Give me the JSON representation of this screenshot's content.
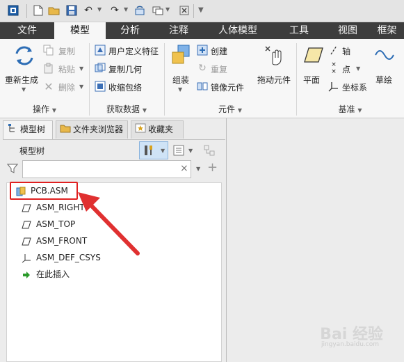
{
  "tabs": [
    {
      "label": "文件",
      "active": false
    },
    {
      "label": "模型",
      "active": true
    },
    {
      "label": "分析",
      "active": false
    },
    {
      "label": "注释",
      "active": false
    },
    {
      "label": "人体模型",
      "active": false
    },
    {
      "label": "工具",
      "active": false
    },
    {
      "label": "视图",
      "active": false
    },
    {
      "label": "框架",
      "active": false
    }
  ],
  "ribbon": {
    "operations": {
      "regenerate": "重新生成",
      "copy": "复制",
      "paste": "粘贴",
      "delete": "删除",
      "group": "操作"
    },
    "get_data": {
      "udf": "用户定义特征",
      "copy_geometry": "复制几何",
      "shrinkwrap": "收缩包络",
      "group": "获取数据"
    },
    "component": {
      "assemble": "组装",
      "create": "创建",
      "repeat": "重复",
      "mirror": "镜像元件",
      "drag": "拖动元件",
      "group": "元件"
    },
    "datum": {
      "plane": "平面",
      "axis": "轴",
      "point": "点",
      "csys": "坐标系",
      "sketch": "草绘",
      "group": "基准"
    }
  },
  "panel": {
    "tabs": [
      "模型树",
      "文件夹浏览器",
      "收藏夹"
    ],
    "tree_title": "模型树",
    "filter_value": "",
    "items": [
      {
        "label": "PCB.ASM",
        "icon": "assembly-icon"
      },
      {
        "label": "ASM_RIGHT",
        "icon": "datum-plane-icon"
      },
      {
        "label": "ASM_TOP",
        "icon": "datum-plane-icon"
      },
      {
        "label": "ASM_FRONT",
        "icon": "datum-plane-icon"
      },
      {
        "label": "ASM_DEF_CSYS",
        "icon": "csys-icon"
      },
      {
        "label": "在此插入",
        "icon": "insert-arrow-icon"
      }
    ]
  },
  "watermark": {
    "text": "Bai 经验",
    "sub": "jingyan.baidu.com"
  },
  "colors": {
    "tab_bar": "#3d3d3d",
    "highlight_box": "#e02020",
    "arrow": "#e03030",
    "accent": "#1a6ec0"
  }
}
